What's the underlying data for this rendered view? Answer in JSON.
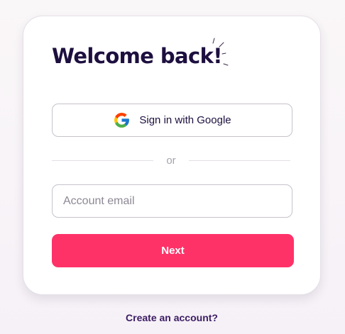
{
  "login": {
    "title": "Welcome back!",
    "google_button_label": "Sign in with Google",
    "divider_text": "or",
    "email_placeholder": "Account email",
    "email_value": "",
    "next_button_label": "Next",
    "create_account_link": "Create an account?"
  },
  "icons": {
    "google": "google-g-logo",
    "sparkle": "sparkle-lines"
  },
  "colors": {
    "primary": "#ff3268",
    "title_text": "#1d0f3f",
    "link_text": "#3b1c63",
    "border": "#c6c2cb",
    "background": "#faf7f8"
  }
}
